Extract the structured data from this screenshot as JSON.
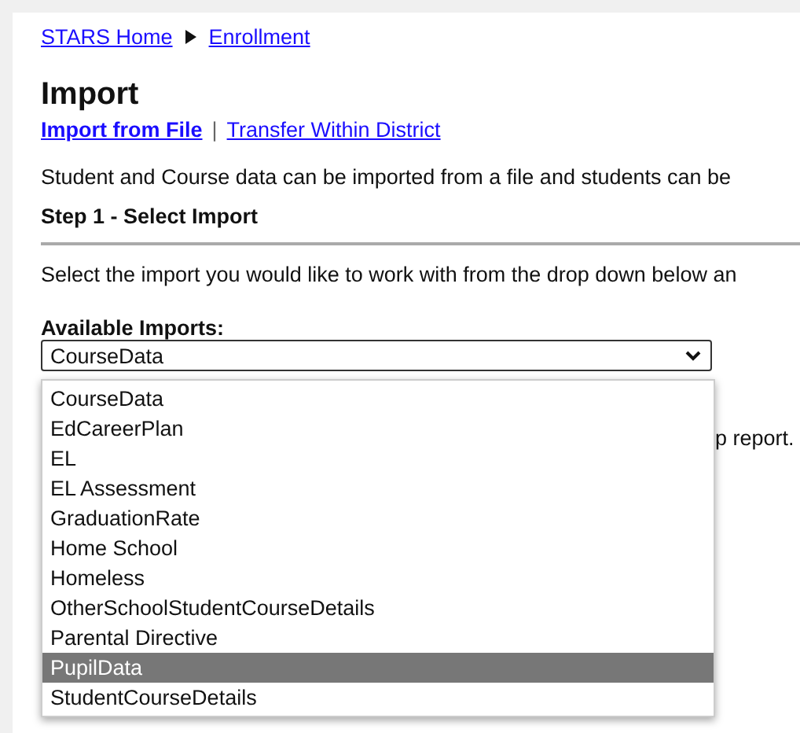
{
  "breadcrumb": [
    {
      "label": "STARS Home"
    },
    {
      "label": "Enrollment"
    }
  ],
  "title": "Import",
  "links": [
    {
      "label": "Import from File",
      "bold": true
    },
    {
      "label": "Transfer Within District",
      "bold": false
    }
  ],
  "link_separator": "|",
  "intro": "Student and Course data can be imported from a file and students can be",
  "step": "Step 1 - Select Import",
  "instruction": "Select the import you would like to work with from the drop down below an",
  "select": {
    "label": "Available Imports:",
    "value": "CourseData",
    "expanded": true,
    "options": [
      {
        "label": "CourseData",
        "highlighted": false
      },
      {
        "label": "EdCareerPlan",
        "highlighted": false
      },
      {
        "label": "EL",
        "highlighted": false
      },
      {
        "label": "EL Assessment",
        "highlighted": false
      },
      {
        "label": "GraduationRate",
        "highlighted": false
      },
      {
        "label": "Home School",
        "highlighted": false
      },
      {
        "label": "Homeless",
        "highlighted": false
      },
      {
        "label": "OtherSchoolStudentCourseDetails",
        "highlighted": false
      },
      {
        "label": "Parental Directive",
        "highlighted": false
      },
      {
        "label": "PupilData",
        "highlighted": true
      },
      {
        "label": "StudentCourseDetails",
        "highlighted": false
      }
    ]
  },
  "hidden_text": "p report."
}
